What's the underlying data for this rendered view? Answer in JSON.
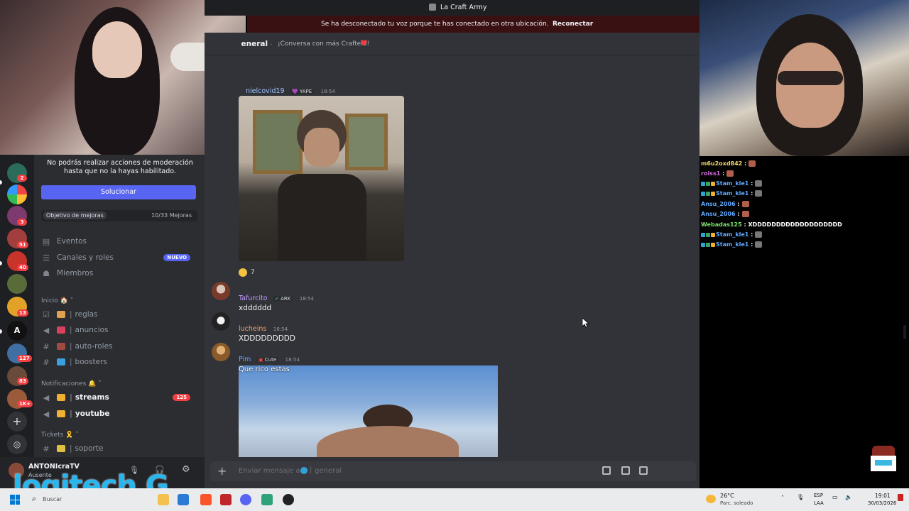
{
  "window": {
    "title": "La Craft Army"
  },
  "disconnect_bar": {
    "message": "Se ha desconectado tu voz porque te has conectado en otra ubicación.",
    "action": "Reconectar"
  },
  "channel_header": {
    "name": "general",
    "topic": "¡Conversa con más Crafters!"
  },
  "sidebar": {
    "notice": "No podrás realizar acciones de moderación hasta que no la hayas habilitado.",
    "fix_button": "Solucionar",
    "goal_label": "Objetivo de mejoras",
    "goal_count": "10/33 Mejoras",
    "items": [
      {
        "label": "Eventos"
      },
      {
        "label": "Canales y roles",
        "badge": "NUEVO"
      },
      {
        "label": "Miembros"
      }
    ],
    "categories": {
      "inicio": "Inicio 🏠",
      "notificaciones": "Notificaciones 🔔",
      "tickets": "Tickets 🎗️"
    },
    "channels_inicio": [
      "reglas",
      "anuncios",
      "auto-roles",
      "boosters"
    ],
    "channels_notif": [
      {
        "label": "streams",
        "count": "125"
      },
      {
        "label": "youtube"
      }
    ],
    "channels_tickets": [
      "soporte"
    ]
  },
  "server_badges": [
    "2",
    "3",
    "51",
    "40",
    "13",
    "127",
    "83",
    "1K+"
  ],
  "messages": [
    {
      "author": "nielcovid19",
      "tag": "💜 YAPE",
      "time": "18:54",
      "reaction_count": "7"
    },
    {
      "author": "Tafurcito",
      "tag": "ARK",
      "time": "18:54",
      "text": "xdddddd"
    },
    {
      "author": "lucheins",
      "time": "18:54",
      "text": "XDDDDDDDDD"
    },
    {
      "author": "Pim",
      "tag": "Cute",
      "time": "18:54",
      "overlay_text": "Que rico estas"
    }
  ],
  "composer": {
    "placeholder": "Enviar mensaje a #",
    "channel": "general"
  },
  "user_panel": {
    "name": "ANTONIcraTV",
    "status": "Ausente"
  },
  "twitch_chat": [
    {
      "user": "m6u2oxd842",
      "color": "#f5d76e",
      "text": ""
    },
    {
      "user": "roiss1",
      "color": "#d86ce3",
      "text": ""
    },
    {
      "user": "Stam_kle1",
      "color": "#5fa9ff",
      "text": "",
      "badges": true
    },
    {
      "user": "Stam_kle1",
      "color": "#5fa9ff",
      "text": "",
      "badges": true
    },
    {
      "user": "Ansu_2006",
      "color": "#5fa9ff",
      "text": ""
    },
    {
      "user": "Ansu_2006",
      "color": "#5fa9ff",
      "text": ""
    },
    {
      "user": "Webadas125",
      "color": "#7ee36e",
      "text": "XDDDDDDDDDDDDDDDDDDD"
    },
    {
      "user": "Stam_kle1",
      "color": "#5fa9ff",
      "text": "",
      "badges": true
    },
    {
      "user": "Stam_kle1",
      "color": "#5fa9ff",
      "text": "",
      "badges": true
    }
  ],
  "taskbar": {
    "search_placeholder": "Buscar",
    "weather_temp": "26°C",
    "weather_desc": "Parc. soleado",
    "lang_top": "ESP",
    "lang_bottom": "LAA",
    "time": "19:01",
    "date": "30/03/2026"
  },
  "overlay_logo": "logitech G",
  "colors": {
    "blurple": "#5865f2",
    "red_badge": "#f23f43",
    "bg_main": "#313338"
  }
}
